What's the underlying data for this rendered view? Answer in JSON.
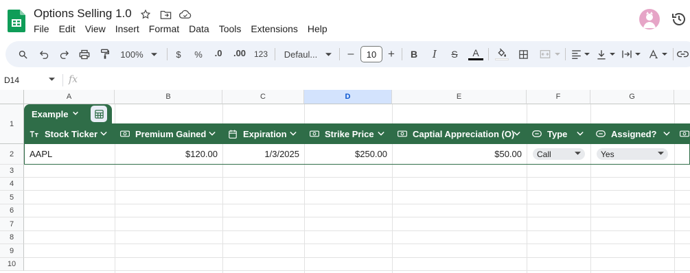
{
  "app": {
    "title": "Options Selling 1.0",
    "menu": [
      "File",
      "Edit",
      "View",
      "Insert",
      "Format",
      "Data",
      "Tools",
      "Extensions",
      "Help"
    ],
    "brand_color": "#0f9d58"
  },
  "toolbar": {
    "zoom": "100%",
    "currency": "$",
    "percent": "%",
    "decrease_decimals": ".0",
    "increase_decimals": ".00",
    "number_format": "123",
    "font": "Defaul...",
    "font_size": "10",
    "minus": "–",
    "plus": "+",
    "bold": "B",
    "italic": "I",
    "strike": "S",
    "text_color": "A",
    "icons": [
      "search-icon",
      "undo-icon",
      "redo-icon",
      "print-icon",
      "paint-format-icon",
      "fill-color-icon",
      "borders-icon",
      "merge-icon",
      "align-icon",
      "valign-icon",
      "wrap-icon",
      "rotate-icon",
      "link-icon"
    ]
  },
  "formula_bar": {
    "cell_ref": "D14",
    "fx": "fx",
    "value": ""
  },
  "grid": {
    "columns": [
      "A",
      "B",
      "C",
      "D",
      "E",
      "F",
      "G"
    ],
    "selected_column": "D",
    "rows": [
      "1",
      "2",
      "3",
      "4",
      "5",
      "6",
      "7",
      "8",
      "9",
      "10"
    ]
  },
  "table": {
    "name": "Example",
    "header_color": "#2f6d48",
    "headers": [
      {
        "label": "Stock Ticker",
        "icon": "text-type-icon"
      },
      {
        "label": "Premium Gained",
        "icon": "money-icon"
      },
      {
        "label": "Expiration",
        "icon": "calendar-icon"
      },
      {
        "label": "Strike Price",
        "icon": "money-icon"
      },
      {
        "label": "Captial Appreciation (O)",
        "icon": "money-icon"
      },
      {
        "label": "Type",
        "icon": "dropdown-chip-icon"
      },
      {
        "label": "Assigned?",
        "icon": "dropdown-chip-icon"
      }
    ],
    "rows": [
      {
        "ticker": "AAPL",
        "premium": "$120.00",
        "expiration": "1/3/2025",
        "strike": "$250.00",
        "appreciation": "$50.00",
        "type": "Call",
        "assigned": "Yes"
      }
    ]
  }
}
